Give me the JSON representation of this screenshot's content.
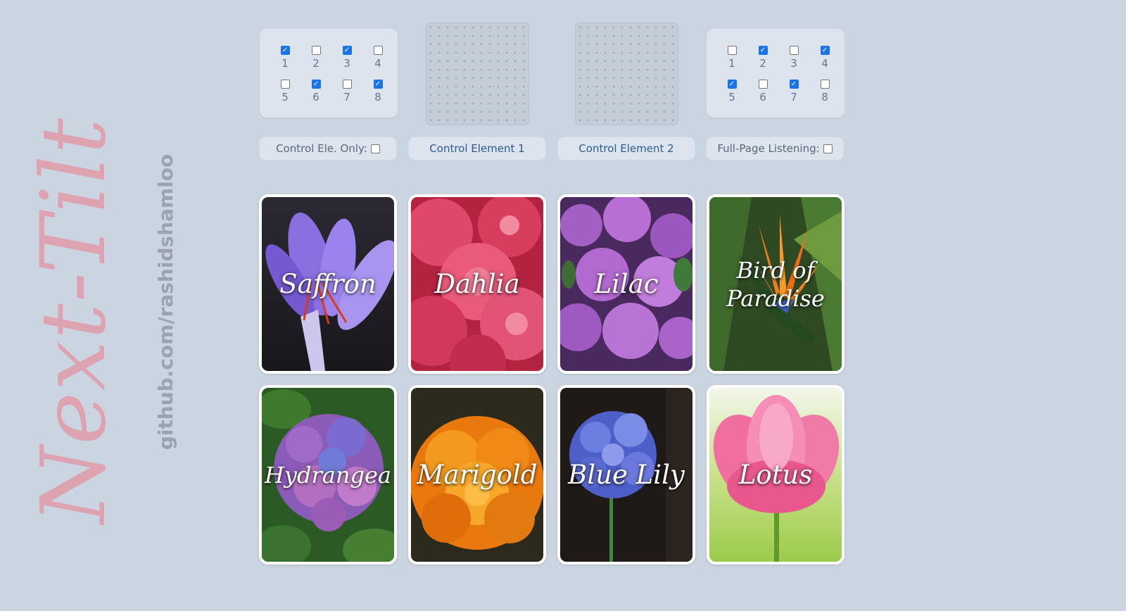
{
  "brand": {
    "title": "Next-Tilt",
    "link": "github.com/rashidshamloo"
  },
  "left_panel": {
    "options": [
      {
        "label": "1",
        "checked": true
      },
      {
        "label": "2",
        "checked": false
      },
      {
        "label": "3",
        "checked": true
      },
      {
        "label": "4",
        "checked": false
      },
      {
        "label": "5",
        "checked": false
      },
      {
        "label": "6",
        "checked": true
      },
      {
        "label": "7",
        "checked": false
      },
      {
        "label": "8",
        "checked": true
      }
    ]
  },
  "right_panel": {
    "options": [
      {
        "label": "1",
        "checked": false
      },
      {
        "label": "2",
        "checked": true
      },
      {
        "label": "3",
        "checked": false
      },
      {
        "label": "4",
        "checked": true
      },
      {
        "label": "5",
        "checked": true
      },
      {
        "label": "6",
        "checked": false
      },
      {
        "label": "7",
        "checked": true
      },
      {
        "label": "8",
        "checked": false
      }
    ]
  },
  "controls": {
    "control_only_label": "Control Ele. Only:",
    "control_only_checked": false,
    "control_element_1": "Control Element 1",
    "control_element_2": "Control Element 2",
    "full_page_label": "Full-Page Listening:",
    "full_page_checked": false
  },
  "cards": [
    {
      "name": "Saffron"
    },
    {
      "name": "Dahlia"
    },
    {
      "name": "Lilac"
    },
    {
      "name": "Bird of Paradise"
    },
    {
      "name": "Hydrangea"
    },
    {
      "name": "Marigold"
    },
    {
      "name": "Blue Lily"
    },
    {
      "name": "Lotus"
    }
  ]
}
